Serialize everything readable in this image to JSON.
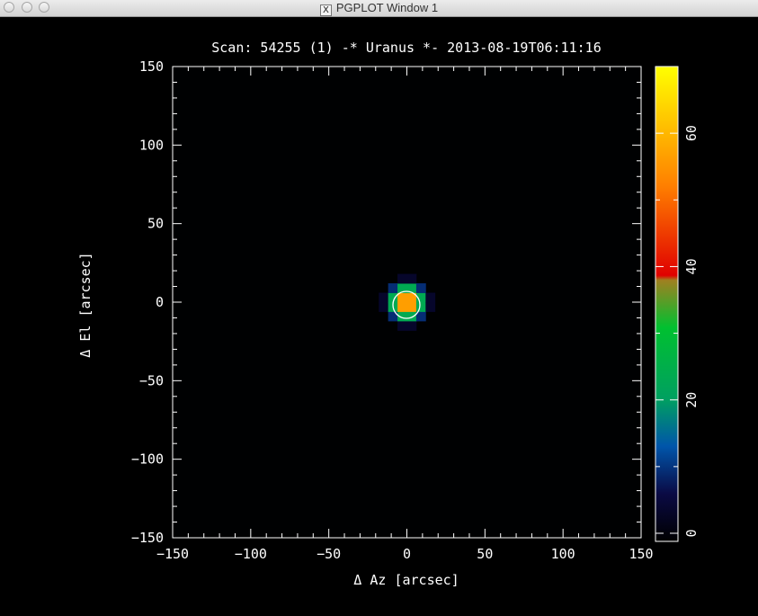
{
  "window": {
    "title": "PGPLOT Window 1",
    "x_badge": "X"
  },
  "plot": {
    "title": "Scan: 54255 (1) -* Uranus *- 2013-08-19T06:11:16",
    "xlabel": "Δ Az [arcsec]",
    "ylabel": "Δ El [arcsec]",
    "xticks": [
      "−150",
      "−100",
      "−50",
      "0",
      "50",
      "100",
      "150"
    ],
    "yticks": [
      "150",
      "100",
      "50",
      "0",
      "−50",
      "−100",
      "−150"
    ],
    "colorbar_ticks": [
      "0",
      "20",
      "40",
      "60"
    ]
  },
  "chart_data": {
    "type": "heatmap",
    "title": "Scan: 54255 (1) -* Uranus *- 2013-08-19T06:11:16",
    "xlabel": "Δ Az [arcsec]",
    "ylabel": "Δ El [arcsec]",
    "xlim": [
      -150,
      150
    ],
    "ylim": [
      -150,
      150
    ],
    "color_range": [
      0,
      70
    ],
    "colorbar_ticks": [
      0,
      20,
      40,
      60
    ],
    "source_peak": {
      "x": 0,
      "y": 0,
      "value": 70
    },
    "beam_marker_center": [
      0,
      0
    ],
    "colormap": [
      "#000000",
      "#0a0a44",
      "#0055aa",
      "#00a060",
      "#00c030",
      "#a08020",
      "#e00000",
      "#ff8000",
      "#ffff00"
    ]
  }
}
